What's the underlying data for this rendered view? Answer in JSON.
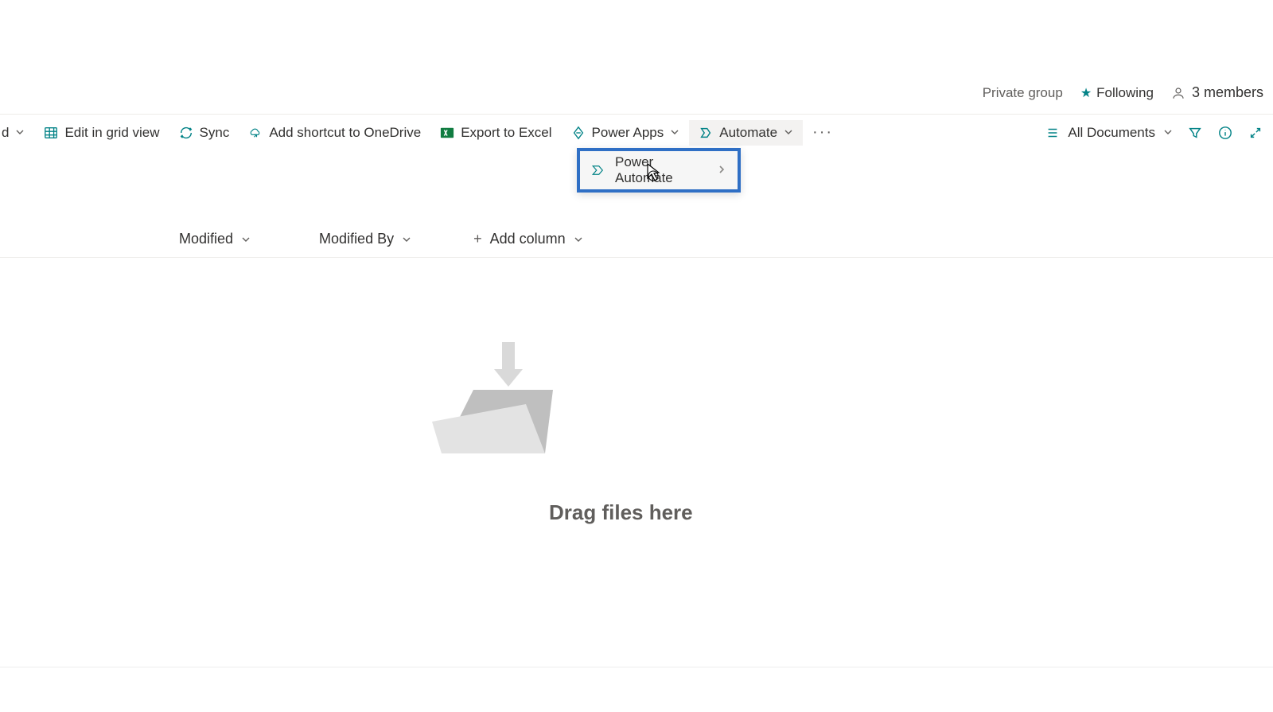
{
  "topinfo": {
    "private_group": "Private group",
    "following": "Following",
    "members": "3 members"
  },
  "commands": {
    "partial_first": "d",
    "edit_grid": "Edit in grid view",
    "sync": "Sync",
    "shortcut": "Add shortcut to OneDrive",
    "export_excel": "Export to Excel",
    "power_apps": "Power Apps",
    "automate": "Automate",
    "more": "···"
  },
  "dropdown": {
    "power_automate": "Power Automate"
  },
  "view": {
    "all_documents": "All Documents"
  },
  "columns": {
    "modified": "Modified",
    "modified_by": "Modified By",
    "add_column": "Add column"
  },
  "empty": {
    "drag": "Drag files here"
  }
}
